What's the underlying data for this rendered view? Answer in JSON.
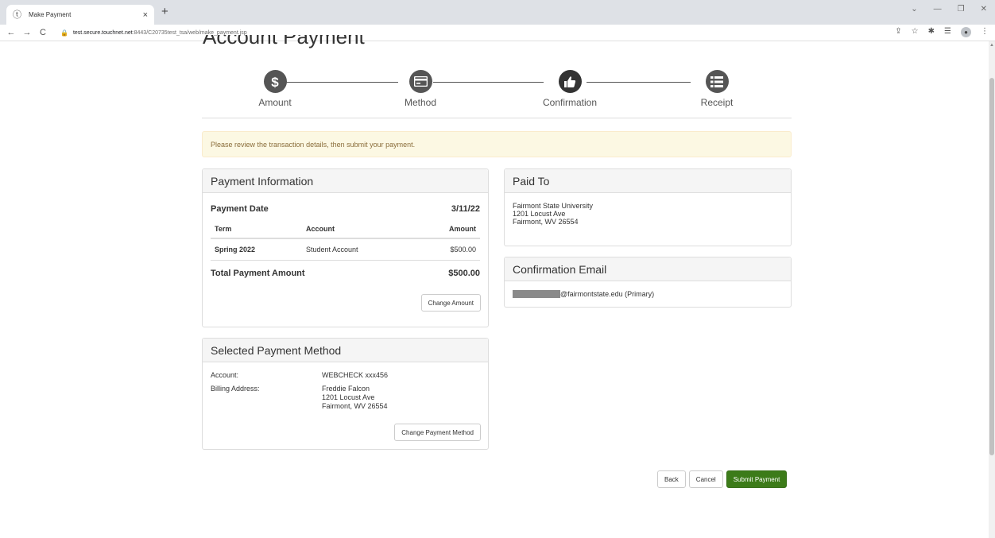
{
  "browser": {
    "tab_title": "Make Payment",
    "tab_close": "×",
    "new_tab": "+",
    "url_host": "test.secure.touchnet.net",
    "url_path": ":8443/C20735test_tsa/web/make_payment.jsp"
  },
  "page": {
    "title": "Account Payment"
  },
  "steps": [
    {
      "label": "Amount",
      "icon": "dollar-icon"
    },
    {
      "label": "Method",
      "icon": "credit-card-icon"
    },
    {
      "label": "Confirmation",
      "icon": "thumbs-up-icon"
    },
    {
      "label": "Receipt",
      "icon": "list-icon"
    }
  ],
  "alert": {
    "text": "Please review the transaction details, then submit your payment."
  },
  "payment_info": {
    "heading": "Payment Information",
    "date_label": "Payment Date",
    "date_value": "3/11/22",
    "columns": [
      "Term",
      "Account",
      "Amount"
    ],
    "rows": [
      {
        "term": "Spring 2022",
        "account": "Student Account",
        "amount": "$500.00"
      }
    ],
    "total_label": "Total Payment Amount",
    "total_value": "$500.00",
    "change_amount_label": "Change Amount"
  },
  "selected_method": {
    "heading": "Selected Payment Method",
    "account_label": "Account:",
    "account_value": "WEBCHECK xxx456",
    "billing_label": "Billing Address:",
    "billing_name": "Freddie Falcon",
    "billing_street": "1201 Locust Ave",
    "billing_city": "Fairmont, WV 26554",
    "change_method_label": "Change Payment Method"
  },
  "paid_to": {
    "heading": "Paid To",
    "name": "Fairmont State University",
    "street": "1201 Locust Ave",
    "city": "Fairmont, WV 26554"
  },
  "confirmation_email": {
    "heading": "Confirmation Email",
    "email_suffix": "@fairmontstate.edu (Primary)"
  },
  "actions": {
    "back_label": "Back",
    "cancel_label": "Cancel",
    "submit_label": "Submit Payment"
  },
  "colors": {
    "primary_button": "#3c7b19",
    "alert_background": "#fcf8e3",
    "alert_text": "#8a6d3b",
    "step_circle": "#555555"
  }
}
